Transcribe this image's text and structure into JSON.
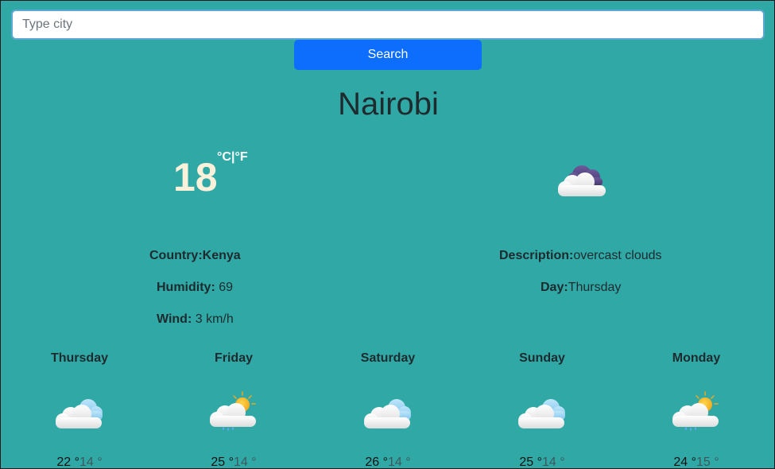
{
  "search": {
    "placeholder": "Type city",
    "button_label": "Search"
  },
  "city": "Nairobi",
  "current": {
    "temperature": "18",
    "unit_c": "°C",
    "unit_sep": "|",
    "unit_f": "°F",
    "icon": "overcast-clouds-icon",
    "country_label": "Country:",
    "country": "Kenya",
    "humidity_label": "Humidity:",
    "humidity": "69",
    "wind_label": "Wind:",
    "wind": "3 km/h",
    "description_label": "Description:",
    "description": "overcast clouds",
    "day_label": "Day:",
    "day": "Thursday"
  },
  "forecast": [
    {
      "day": "Thursday",
      "icon": "cloudy-icon",
      "max": "22 °",
      "min": "14 °"
    },
    {
      "day": "Friday",
      "icon": "sun-rain-icon",
      "max": "25 °",
      "min": "14 °"
    },
    {
      "day": "Saturday",
      "icon": "cloudy-icon",
      "max": "26 °",
      "min": "14 °"
    },
    {
      "day": "Sunday",
      "icon": "cloudy-icon",
      "max": "25 °",
      "min": "14 °"
    },
    {
      "day": "Monday",
      "icon": "sun-rain-icon",
      "max": "24 °",
      "min": "15 °"
    }
  ],
  "colors": {
    "background": "#30a9a6",
    "button": "#0d6efd",
    "temperature": "#fbf0d9"
  }
}
